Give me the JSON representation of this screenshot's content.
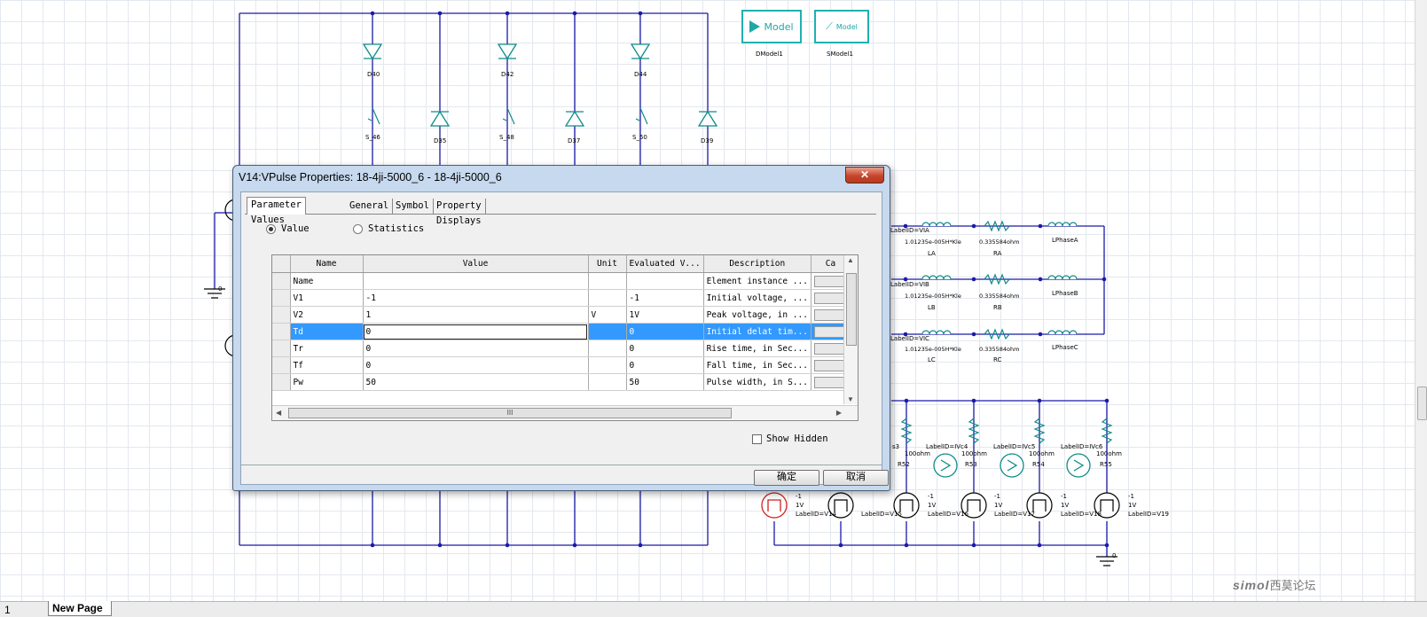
{
  "schematic": {
    "top_bridge_labels": [
      "D40",
      "D35",
      "D42",
      "D37",
      "D44",
      "D39"
    ],
    "switch_labels": [
      "S_46",
      "S_48",
      "S_50"
    ],
    "models": [
      {
        "box_label": "Model",
        "caption": "DModel1",
        "icon": "diode-icon"
      },
      {
        "box_label": "Model",
        "caption": "SModel1",
        "icon": "switch-icon"
      }
    ],
    "phases": [
      {
        "label_id": "LabelID=VIA",
        "inductance": "1.01235e-005H*Kle",
        "l_name": "LA",
        "resistance": "0.335584ohm",
        "r_name": "RA",
        "lphase": "LPhaseA"
      },
      {
        "label_id": "LabelID=VIB",
        "inductance": "1.01235e-005H*Kle",
        "l_name": "LB",
        "resistance": "0.335584ohm",
        "r_name": "RB",
        "lphase": "LPhaseB"
      },
      {
        "label_id": "LabelID=VIC",
        "inductance": "1.01235e-005H*Kle",
        "l_name": "LC",
        "resistance": "0.335584ohm",
        "r_name": "RC",
        "lphase": "LPhaseC"
      }
    ],
    "ground_label_left": "0",
    "ground_label_bottom": "0",
    "probes": [
      "LabelID=IVc4",
      "LabelID=IVc5",
      "LabelID=IVc6"
    ],
    "resistor_value": "100ohm",
    "res_names": [
      "R53",
      "R54",
      "R55"
    ],
    "res_names_partial": [
      "s3",
      "R52"
    ],
    "pulse_src_vals": [
      "-1",
      "1V"
    ],
    "pulse_src_labels": [
      "LabelID=V14",
      "LabelID=V15",
      "LabelID=V16",
      "LabelID=V17",
      "LabelID=V18",
      "LabelID=V19"
    ]
  },
  "dialog": {
    "title": "V14:VPulse Properties: 18-4ji-5000_6 - 18-4ji-5000_6",
    "close_glyph": "✕",
    "tabs": [
      "Parameter Values",
      "General",
      "Symbol",
      "Property Displays"
    ],
    "radio_value": "Value",
    "radio_statistics": "Statistics",
    "columns": [
      "Name",
      "Value",
      "Unit",
      "Evaluated V...",
      "Description",
      "Ca"
    ],
    "rows": [
      {
        "name": "Name",
        "value": "",
        "unit": "",
        "evaluated": "",
        "description": "Element instance ..."
      },
      {
        "name": "V1",
        "value": "-1",
        "unit": "",
        "evaluated": "-1",
        "description": "Initial voltage, ..."
      },
      {
        "name": "V2",
        "value": "1",
        "unit": "V",
        "evaluated": "1V",
        "description": "Peak voltage, in ..."
      },
      {
        "name": "Td",
        "value": "0",
        "unit": "",
        "evaluated": "0",
        "description": "Initial delat tim..."
      },
      {
        "name": "Tr",
        "value": "0",
        "unit": "",
        "evaluated": "0",
        "description": "Rise time, in Sec..."
      },
      {
        "name": "Tf",
        "value": "0",
        "unit": "",
        "evaluated": "0",
        "description": "Fall time, in Sec..."
      },
      {
        "name": "Pw",
        "value": "50",
        "unit": "",
        "evaluated": "50",
        "description": "Pulse width, in S..."
      }
    ],
    "selected_row": 3,
    "hscroll_grip": "III",
    "show_hidden": "Show Hidden",
    "ok": "确定",
    "cancel": "取消"
  },
  "bottom": {
    "page_number": "1",
    "tab": "New Page",
    "watermark_latin": "simol",
    "watermark_cn": "西莫论坛"
  }
}
